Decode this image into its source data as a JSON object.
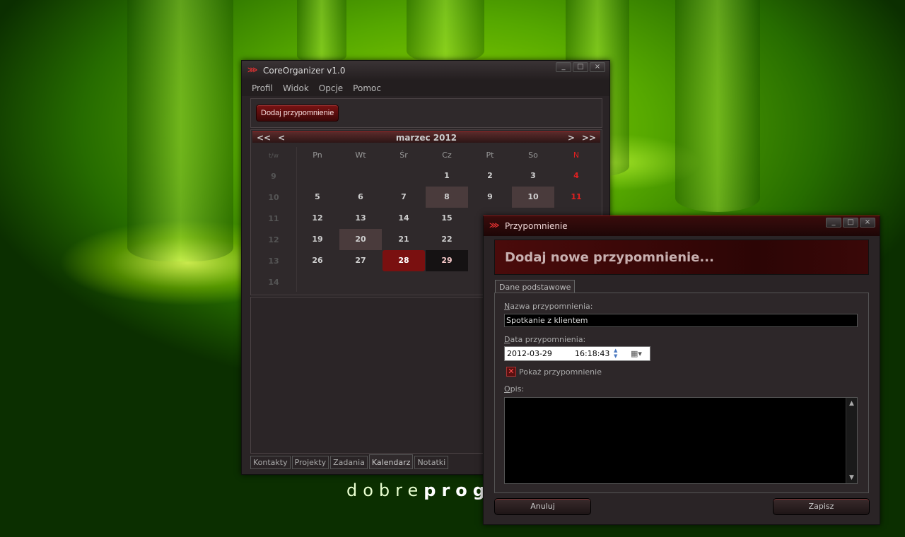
{
  "wallpaper": {
    "brand_light": "dobre",
    "brand_bold": "prog"
  },
  "main_window": {
    "title": "CoreOrganizer v1.0",
    "controls": [
      "_",
      "□",
      "×"
    ],
    "menu": [
      "Profil",
      "Widok",
      "Opcje",
      "Pomoc"
    ],
    "add_button": "Dodaj przypomnienie",
    "calendar": {
      "month_label": "marzec 2012",
      "nav": {
        "prev_year": "<<",
        "prev": "<",
        "next": ">",
        "next_year": ">>"
      },
      "week_header": "t/w",
      "weekdays": [
        "Pn",
        "Wt",
        "Śr",
        "Cz",
        "Pt",
        "So",
        "N"
      ],
      "week_numbers": [
        "9",
        "10",
        "11",
        "12",
        "13",
        "14"
      ],
      "rows": [
        [
          "",
          "",
          "",
          "1",
          "2",
          "3",
          "4"
        ],
        [
          "5",
          "6",
          "7",
          "8",
          "9",
          "10",
          "11"
        ],
        [
          "12",
          "13",
          "14",
          "15",
          "",
          "",
          ""
        ],
        [
          "19",
          "20",
          "21",
          "22",
          "",
          "",
          ""
        ],
        [
          "26",
          "27",
          "28",
          "29",
          "",
          "",
          ""
        ]
      ],
      "highlighted_days": [
        "8",
        "10",
        "20"
      ],
      "selected_day": "28",
      "today_day": "29",
      "sunday_color": "#e02020"
    },
    "bottom_tabs": [
      "Kontakty",
      "Projekty",
      "Zadania",
      "Kalendarz",
      "Notatki"
    ],
    "active_tab": "Kalendarz"
  },
  "dialog": {
    "title": "Przypomnienie",
    "controls": [
      "_",
      "□",
      "×"
    ],
    "header": "Dodaj nowe przypomnienie...",
    "tab": "Dane podstawowe",
    "name_label_u": "N",
    "name_label_rest": "azwa przypomnienia:",
    "name_value": "Spotkanie z klientem",
    "date_label_u": "D",
    "date_label_rest": "ata przypomnienia:",
    "date_value": "2012-03-29",
    "time_value": "16:18:43",
    "show_checkbox_label": "Pokaż przypomnienie",
    "desc_label_u": "O",
    "desc_label_rest": "pis:",
    "desc_value": "",
    "cancel": "Anuluj",
    "save": "Zapisz"
  },
  "colors": {
    "accent_red": "#7a1313",
    "window_bg": "#2a2426",
    "wallpaper_green": "#56a800"
  }
}
